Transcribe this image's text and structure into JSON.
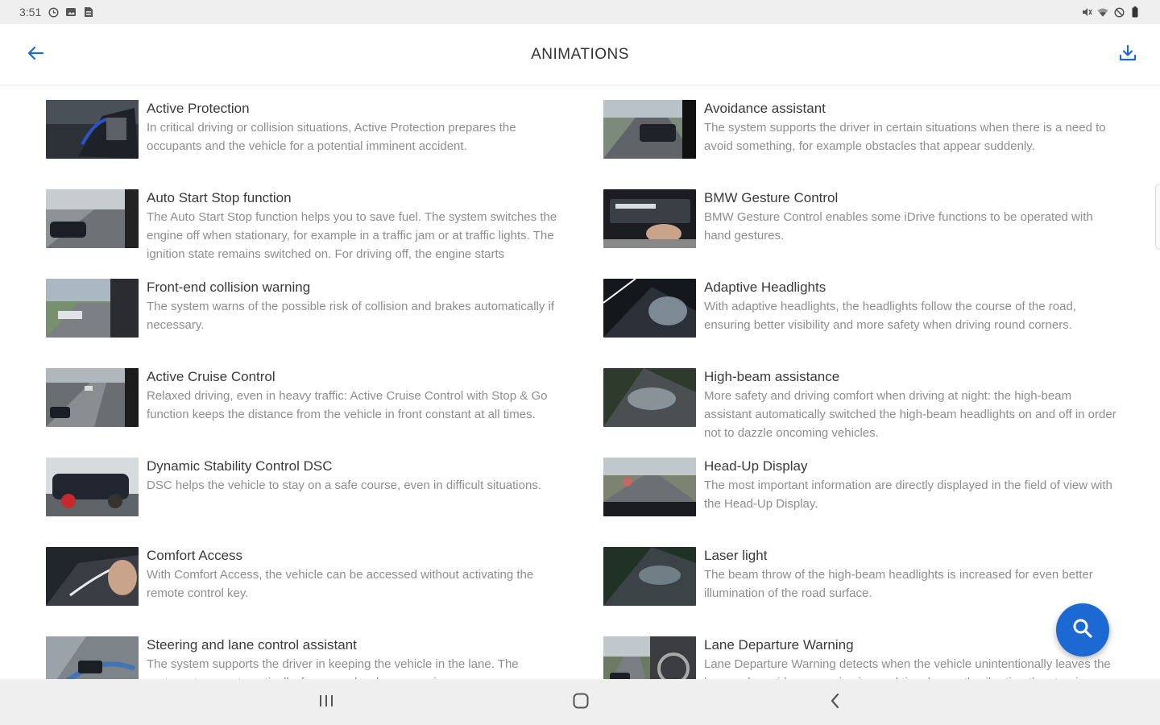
{
  "status_bar": {
    "time": "3:51"
  },
  "app_bar": {
    "title": "ANIMATIONS",
    "back_icon": "arrow-left-icon",
    "download_icon": "download-icon"
  },
  "colors": {
    "accent": "#1c69d4"
  },
  "items": [
    {
      "title": "Active Protection",
      "desc": "In critical driving or collision situations, Active Protection prepares the occupants and the vehicle for a potential imminent accident."
    },
    {
      "title": "Avoidance assistant",
      "desc": "The system supports the driver in certain situations when there is a need to avoid something, for example obstacles that appear suddenly."
    },
    {
      "title": "Auto Start Stop function",
      "desc": "The Auto Start Stop function helps you to save fuel. The system switches the engine off when stationary, for example in a traffic jam or at traffic lights. The ignition state remains switched on. For driving off, the engine starts automatically."
    },
    {
      "title": "BMW Gesture Control",
      "desc": "BMW Gesture Control enables some iDrive functions to be operated with hand gestures."
    },
    {
      "title": "Front-end collision warning",
      "desc": "The system warns of the possible risk of collision and brakes automatically if necessary."
    },
    {
      "title": "Adaptive Headlights",
      "desc": "With adaptive headlights, the headlights follow the course of the road, ensuring better visibility and more safety when driving round corners."
    },
    {
      "title": "Active Cruise Control",
      "desc": "Relaxed driving, even in heavy traffic: Active Cruise Control with Stop & Go function keeps the distance from the vehicle in front constant at all times."
    },
    {
      "title": "High-beam assistance",
      "desc": "More safety and driving comfort when driving at night: the high-beam assistant automatically switched the high-beam headlights on and off in order not to dazzle oncoming vehicles."
    },
    {
      "title": "Dynamic Stability Control DSC",
      "desc": "DSC helps the vehicle to stay on a safe course, even in difficult situations."
    },
    {
      "title": "Head-Up Display",
      "desc": "The most important information are directly displayed in the field of view with the Head-Up Display."
    },
    {
      "title": "Comfort Access",
      "desc": "With Comfort Access, the vehicle can be accessed without activating the remote control key."
    },
    {
      "title": "Laser light",
      "desc": "The beam throw of the high-beam headlights is increased for even better illumination of the road surface."
    },
    {
      "title": "Steering and lane control assistant",
      "desc": "The system supports the driver in keeping the vehicle in the lane. The system steers automatically, for example when cornering."
    },
    {
      "title": "Lane Departure Warning",
      "desc": "Lane Departure Warning detects when the vehicle unintentionally leaves the lane and provides a warning in good time by gently vibrating the steering wheel."
    }
  ],
  "fab": {
    "icon": "search-icon"
  },
  "nav_bar": {
    "recents_icon": "recents-icon",
    "home_icon": "home-icon",
    "back_icon": "nav-back-icon"
  }
}
